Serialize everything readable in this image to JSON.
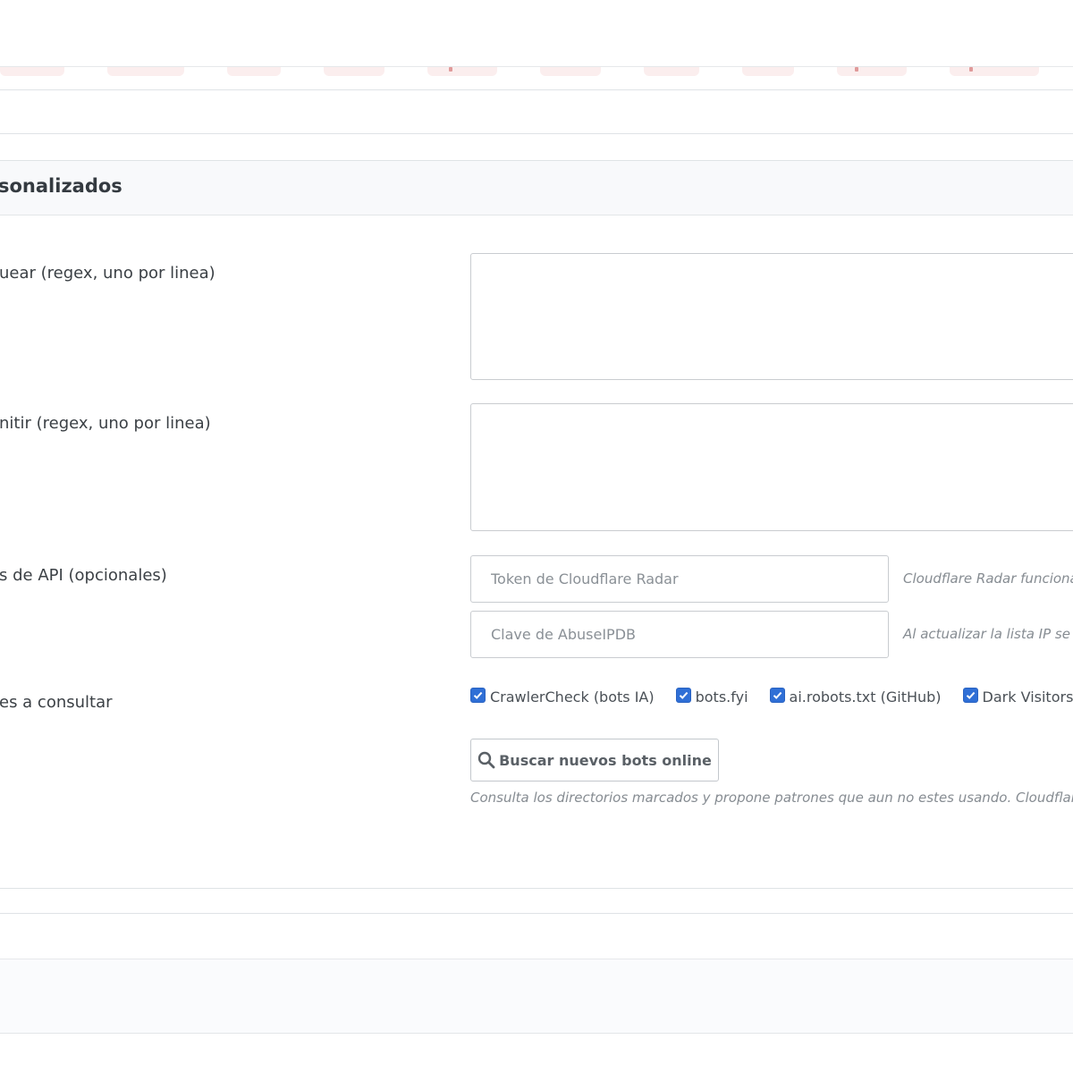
{
  "section": {
    "title": "sonalizados"
  },
  "rows": {
    "block_label": "uear (regex, uno por linea)",
    "allow_label": "nitir (regex, uno por linea)",
    "api_label": "s de API (opcionales)",
    "sources_label": "es a consultar"
  },
  "api": {
    "cloudflare_placeholder": "Token de Cloudflare Radar",
    "cloudflare_help": "Cloudflare Radar funciona",
    "abuse_placeholder": "Clave de AbuseIPDB",
    "abuse_help": "Al actualizar la lista IP se f"
  },
  "sources": {
    "items": [
      {
        "label": "CrawlerCheck (bots IA)",
        "checked": true
      },
      {
        "label": "bots.fyi",
        "checked": true
      },
      {
        "label": "ai.robots.txt (GitHub)",
        "checked": true
      },
      {
        "label": "Dark Visitors",
        "checked": true
      }
    ],
    "search_button": "Buscar nuevos bots online",
    "search_help": "Consulta los directorios marcados y propone patrones que aun no estes usando. Cloudflare R"
  },
  "icons": {
    "search": "search-icon",
    "check": "checkmark-icon"
  },
  "colors": {
    "accent": "#2f6fd6",
    "tag_tint": "#fbeeee"
  }
}
